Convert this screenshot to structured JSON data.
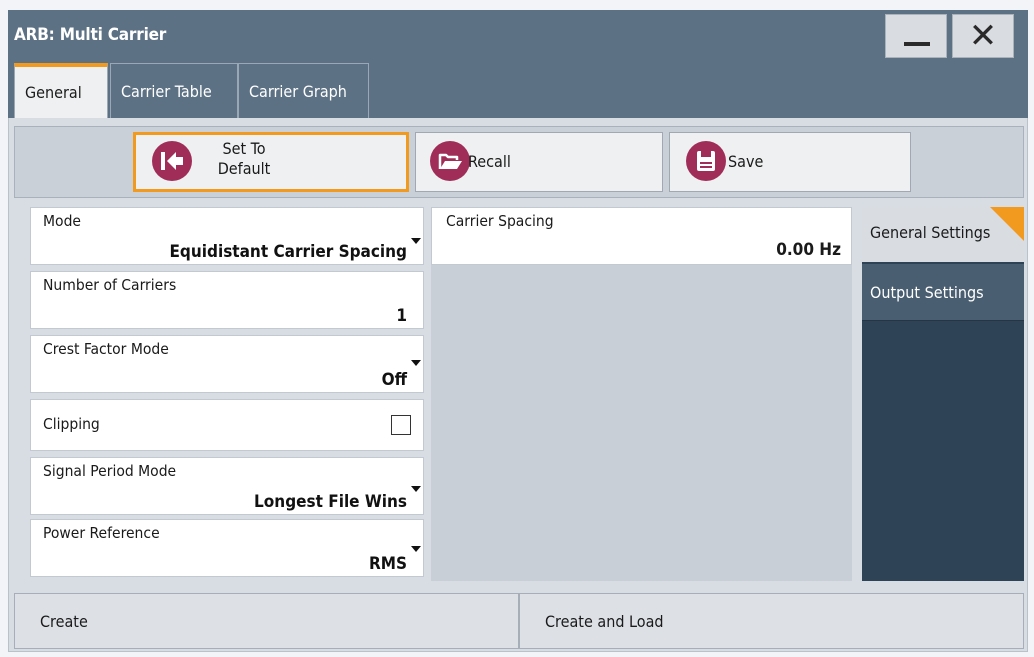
{
  "window": {
    "title": "ARB: Multi Carrier",
    "minimize_label": "—",
    "close_label": "✕"
  },
  "tabs": [
    {
      "label": "General",
      "active": true
    },
    {
      "label": "Carrier Table",
      "active": false
    },
    {
      "label": "Carrier Graph",
      "active": false
    }
  ],
  "toolbar": {
    "set_default_line1": "Set To",
    "set_default_line2": "Default",
    "recall_label": "Recall",
    "save_label": "Save",
    "icons": [
      "arrow-left-icon",
      "folder-open-icon",
      "save-disk-icon"
    ],
    "icon_color": "#a02d58"
  },
  "params": {
    "mode": {
      "label": "Mode",
      "value": "Equidistant Carrier Spacing"
    },
    "number_of_carriers": {
      "label": "Number of Carriers",
      "value": "1"
    },
    "crest_factor_mode": {
      "label": "Crest Factor Mode",
      "value": "Off"
    },
    "clipping": {
      "label": "Clipping",
      "checked": false
    },
    "signal_period_mode": {
      "label": "Signal Period Mode",
      "value": "Longest File Wins"
    },
    "power_reference": {
      "label": "Power Reference",
      "value": "RMS"
    },
    "carrier_spacing": {
      "label": "Carrier Spacing",
      "value": "0.00 Hz"
    }
  },
  "side_tabs": [
    {
      "label": "General Settings",
      "active": true
    },
    {
      "label": "Output Settings",
      "active": false
    }
  ],
  "bottom": {
    "create_label": "Create",
    "create_load_label": "Create and Load"
  },
  "colors": {
    "accent": "#f29a1f",
    "title_bar": "#5d7185",
    "side_panel": "#2f4356"
  }
}
